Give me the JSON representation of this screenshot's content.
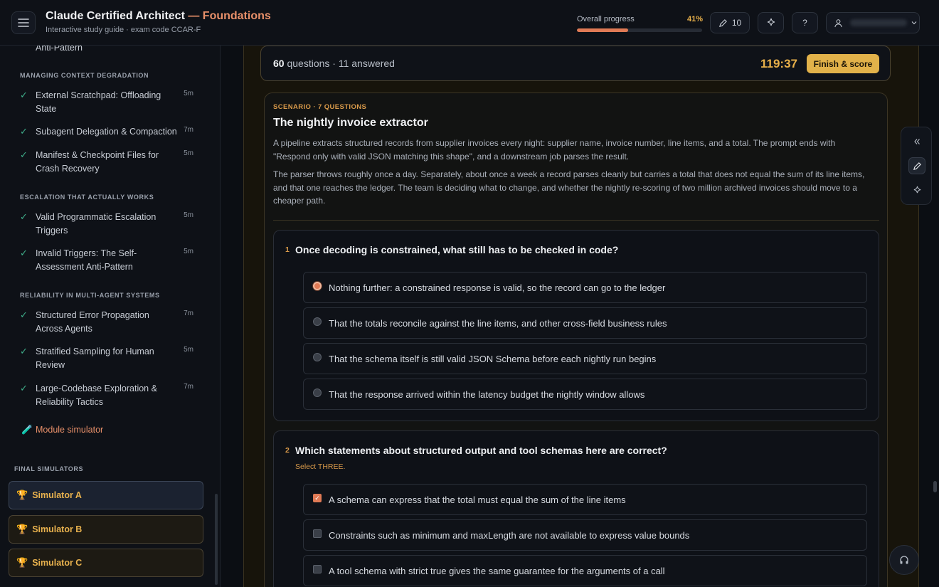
{
  "header": {
    "title": "Claude Certified Architect",
    "title_accent": "— Foundations",
    "subtitle": "Interactive study guide · exam code CCAR-F",
    "progress_label": "Overall progress",
    "progress_value": "41%",
    "progress_fraction": 0.41,
    "notes_count": "10",
    "help_label": "?",
    "icons": [
      "menu-icon",
      "pencil-icon",
      "sparkle-icon",
      "user-icon",
      "chevron-down-icon"
    ]
  },
  "sidebar": {
    "top_partial": "Anti-Pattern",
    "sections": [
      {
        "title": "MANAGING CONTEXT DEGRADATION",
        "items": [
          {
            "label": "External Scratchpad: Offloading State",
            "duration": "5m"
          },
          {
            "label": "Subagent Delegation & Compaction",
            "duration": "7m"
          },
          {
            "label": "Manifest & Checkpoint Files for Crash Recovery",
            "duration": "5m"
          }
        ]
      },
      {
        "title": "ESCALATION THAT ACTUALLY WORKS",
        "items": [
          {
            "label": "Valid Programmatic Escalation Triggers",
            "duration": "5m"
          },
          {
            "label": "Invalid Triggers: The Self-Assessment Anti-Pattern",
            "duration": "5m"
          }
        ]
      },
      {
        "title": "RELIABILITY IN MULTI-AGENT SYSTEMS",
        "items": [
          {
            "label": "Structured Error Propagation Across Agents",
            "duration": "7m"
          },
          {
            "label": "Stratified Sampling for Human Review",
            "duration": "5m"
          },
          {
            "label": "Large-Codebase Exploration & Reliability Tactics",
            "duration": "7m"
          }
        ]
      }
    ],
    "module_simulator": "Module simulator",
    "final_title": "FINAL SIMULATORS",
    "simulators": [
      "Simulator A",
      "Simulator B",
      "Simulator C"
    ]
  },
  "quiz": {
    "question_count": "60",
    "count_suffix": "questions · 11 answered",
    "timer": "119:37",
    "finish_label": "Finish & score"
  },
  "scenario": {
    "kicker": "SCENARIO · 7 QUESTIONS",
    "title": "The nightly invoice extractor",
    "p1": "A pipeline extracts structured records from supplier invoices every night: supplier name, invoice number, line items, and a total. The prompt ends with \"Respond only with valid JSON matching this shape\", and a downstream job parses the result.",
    "p2": "The parser throws roughly once a day. Separately, about once a week a record parses cleanly but carries a total that does not equal the sum of its line items, and that one reaches the ledger. The team is deciding what to change, and whether the nightly re-scoring of two million archived invoices should move to a cheaper path."
  },
  "questions": [
    {
      "num": "1",
      "text": "Once decoding is constrained, what still has to be checked in code?",
      "options": [
        {
          "text": "Nothing further: a constrained response is valid, so the record can go to the ledger",
          "selected": true
        },
        {
          "text": "That the totals reconcile against the line items, and other cross-field business rules",
          "selected": false
        },
        {
          "text": "That the schema itself is still valid JSON Schema before each nightly run begins",
          "selected": false
        },
        {
          "text": "That the response arrived within the latency budget the nightly window allows",
          "selected": false
        }
      ]
    },
    {
      "num": "2",
      "text": "Which statements about structured output and tool schemas here are correct?",
      "hint": "Select THREE.",
      "options": [
        {
          "text": "A schema can express that the total must equal the sum of the line items",
          "selected": true
        },
        {
          "text": "Constraints such as minimum and maxLength are not available to express value bounds",
          "selected": false
        },
        {
          "text": "A tool schema with strict true gives the same guarantee for the arguments of a call",
          "selected": false
        }
      ]
    }
  ],
  "colors": {
    "accent": "#e07a55",
    "gold": "#e2b24a",
    "check": "#3fae8a"
  }
}
